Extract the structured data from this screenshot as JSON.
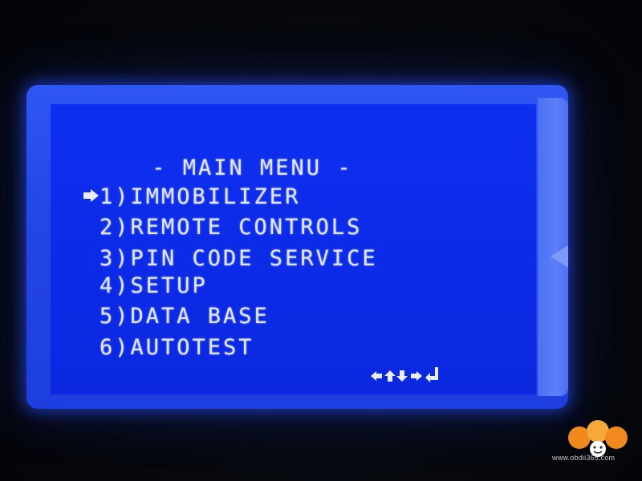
{
  "screen": {
    "title": " - MAIN MENU -",
    "selected_index": 1,
    "menu_items": [
      {
        "label": "1)IMMOBILIZER"
      },
      {
        "label": "2)REMOTE CONTROLS"
      },
      {
        "label": "3)PIN CODE SERVICE"
      },
      {
        "label": "4)SETUP"
      },
      {
        "label": "5)DATA BASE"
      },
      {
        "label": "6)AUTOTEST"
      }
    ],
    "key_legend_icons": [
      "arrow-left-icon",
      "arrow-up-icon",
      "arrow-down-icon",
      "arrow-right-icon",
      "enter-icon"
    ],
    "colors": {
      "background": "#0c2be8",
      "text": "#dfe6ff",
      "glow": "#2f56f3"
    }
  },
  "watermark": {
    "logo_text": "365",
    "url": "www.obdii365.com"
  }
}
